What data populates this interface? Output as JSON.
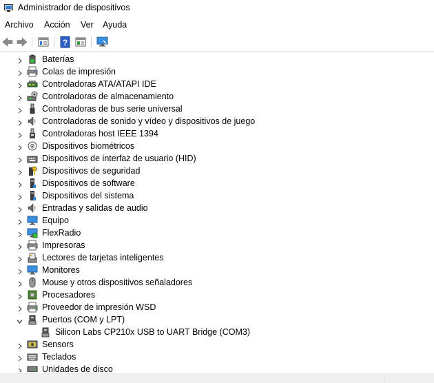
{
  "window": {
    "title": "Administrador de dispositivos",
    "icon": "device-manager-icon"
  },
  "menubar": {
    "items": [
      "Archivo",
      "Acción",
      "Ver",
      "Ayuda"
    ]
  },
  "toolbar": {
    "buttons": [
      "back-icon",
      "forward-icon",
      "properties-icon",
      "help-icon",
      "view-icon",
      "monitor-scan-icon"
    ]
  },
  "tree": {
    "nodes": [
      {
        "label": "Baterías",
        "icon": "battery-icon",
        "expanded": false
      },
      {
        "label": "Colas de impresión",
        "icon": "printer-queue-icon",
        "expanded": false
      },
      {
        "label": "Controladoras ATA/ATAPI IDE",
        "icon": "ide-controller-icon",
        "expanded": false
      },
      {
        "label": "Controladoras de almacenamiento",
        "icon": "storage-controller-icon",
        "expanded": false
      },
      {
        "label": "Controladoras de bus serie universal",
        "icon": "usb-icon",
        "expanded": false
      },
      {
        "label": "Controladoras de sonido y vídeo y dispositivos de juego",
        "icon": "speaker-icon",
        "expanded": false
      },
      {
        "label": "Controladoras host IEEE 1394",
        "icon": "firewire-icon",
        "expanded": false
      },
      {
        "label": "Dispositivos biométricos",
        "icon": "fingerprint-icon",
        "expanded": false
      },
      {
        "label": "Dispositivos de interfaz de usuario (HID)",
        "icon": "hid-icon",
        "expanded": false
      },
      {
        "label": "Dispositivos de seguridad",
        "icon": "security-key-icon",
        "expanded": false
      },
      {
        "label": "Dispositivos de software",
        "icon": "software-device-icon",
        "expanded": false
      },
      {
        "label": "Dispositivos del sistema",
        "icon": "system-device-icon",
        "expanded": false
      },
      {
        "label": "Entradas y salidas de audio",
        "icon": "audio-io-icon",
        "expanded": false
      },
      {
        "label": "Equipo",
        "icon": "computer-icon",
        "expanded": false
      },
      {
        "label": "FlexRadio",
        "icon": "network-computer-icon",
        "expanded": false
      },
      {
        "label": "Impresoras",
        "icon": "printer-icon",
        "expanded": false
      },
      {
        "label": "Lectores de tarjetas inteligentes",
        "icon": "smart-card-reader-icon",
        "expanded": false
      },
      {
        "label": "Monitores",
        "icon": "monitor-icon",
        "expanded": false
      },
      {
        "label": "Mouse y otros dispositivos señaladores",
        "icon": "mouse-icon",
        "expanded": false
      },
      {
        "label": "Procesadores",
        "icon": "processor-icon",
        "expanded": false
      },
      {
        "label": "Proveedor de impresión WSD",
        "icon": "wsd-printer-icon",
        "expanded": false
      },
      {
        "label": "Puertos (COM y LPT)",
        "icon": "port-icon",
        "expanded": true,
        "children": [
          {
            "label": "Silicon Labs CP210x USB to UART Bridge (COM3)",
            "icon": "port-icon"
          }
        ]
      },
      {
        "label": "Sensors",
        "icon": "sensor-icon",
        "expanded": false
      },
      {
        "label": "Teclados",
        "icon": "keyboard-icon",
        "expanded": false
      },
      {
        "label": "Unidades de disco",
        "icon": "disk-drive-icon",
        "expanded": false
      }
    ]
  },
  "colors": {
    "accent_blue": "#1e78d0",
    "arrow_gray": "#7a7a7a",
    "tree_chevron": "#5a5a5a"
  }
}
